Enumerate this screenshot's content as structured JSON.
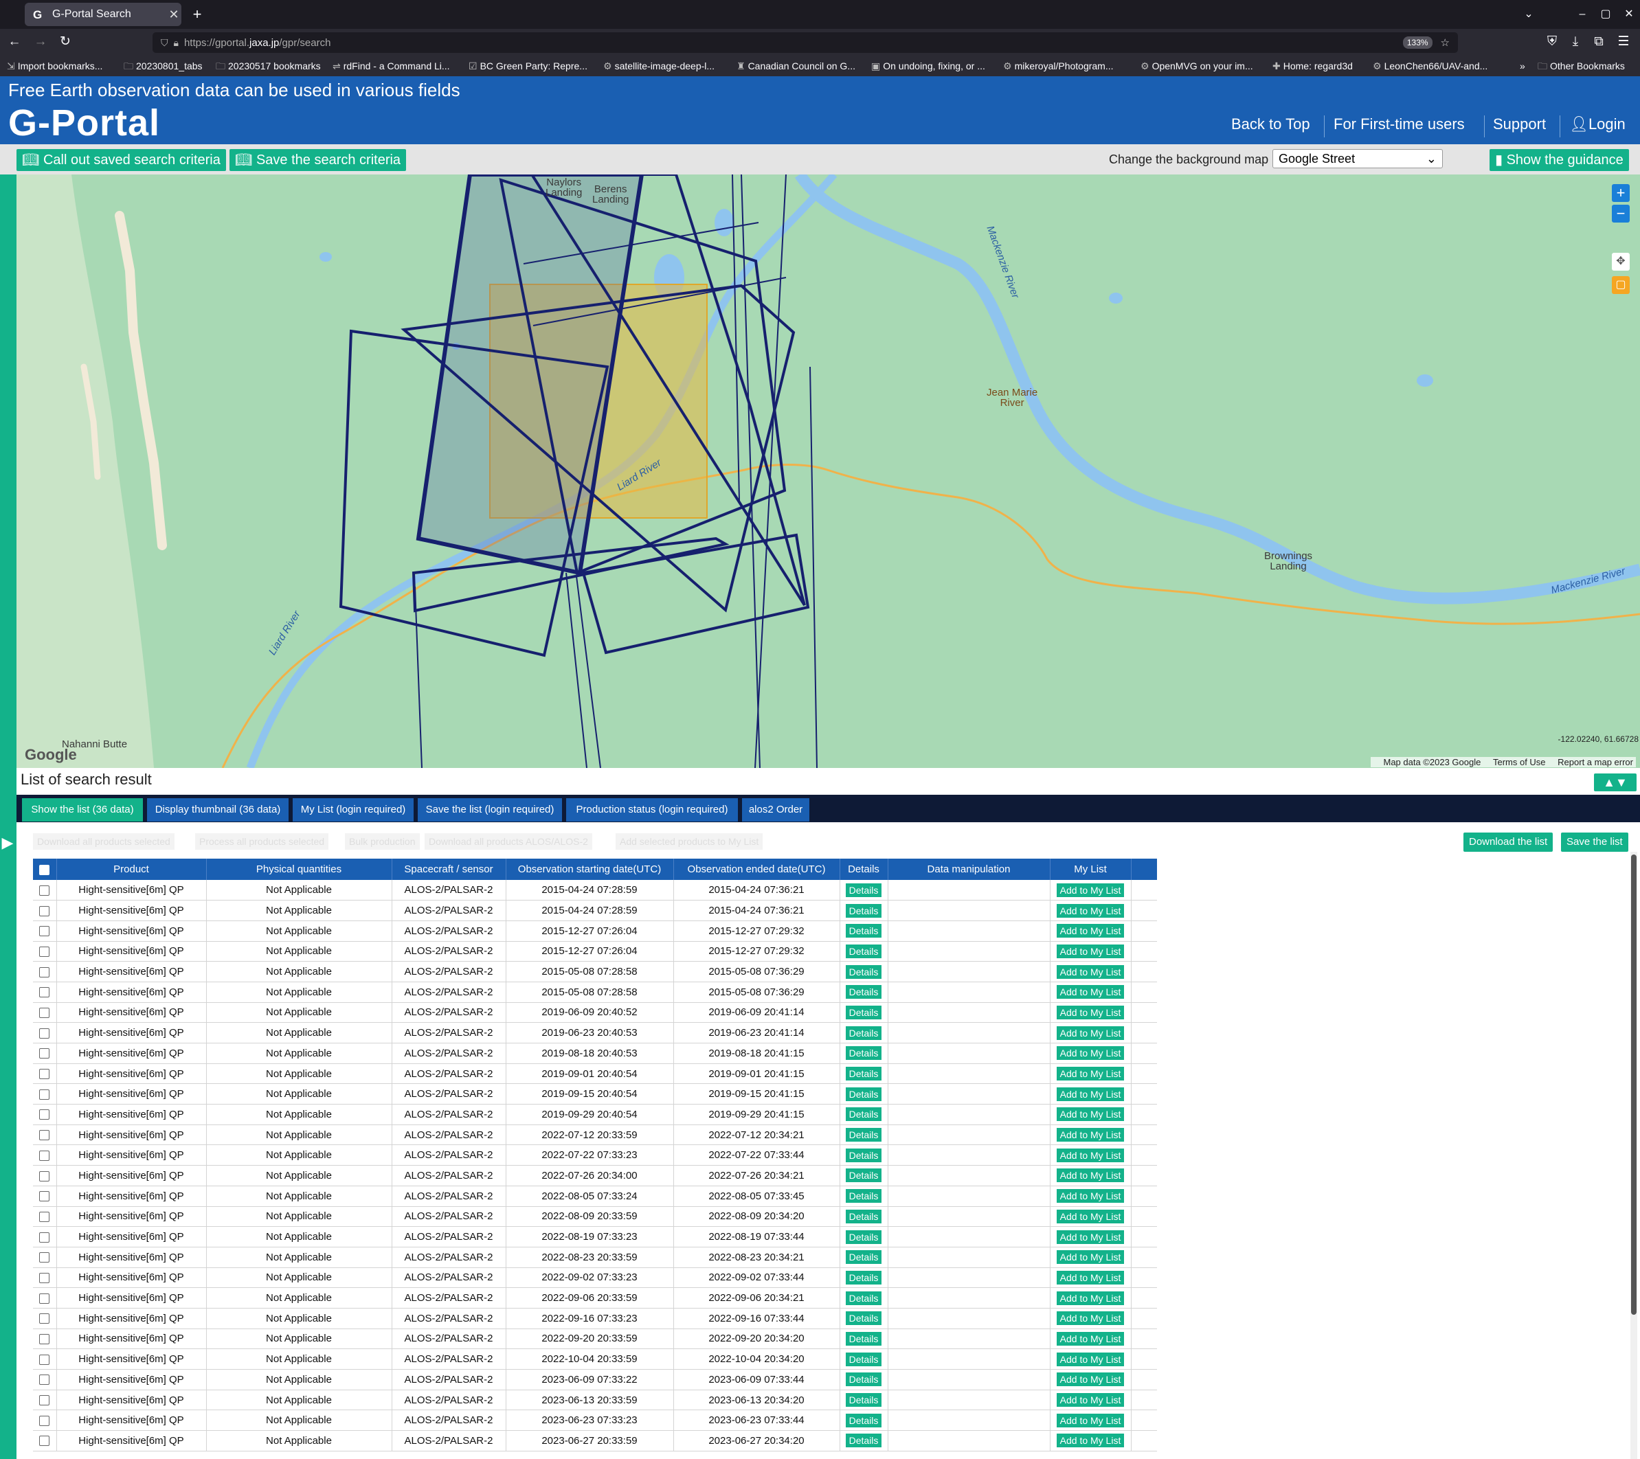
{
  "browser": {
    "tab_title": "G-Portal Search",
    "tab_favicon": "G",
    "url_prefix": "https://gportal.",
    "url_domain": "jaxa.jp",
    "url_path": "/gpr/search",
    "zoom": "133%",
    "bookmarks": [
      "Import bookmarks...",
      "20230801_tabs",
      "20230517 bookmarks",
      "rdFind - a Command Li...",
      "BC Green Party: Repre...",
      "satellite-image-deep-l...",
      "Canadian Council on G...",
      "On undoing, fixing, or ...",
      "mikeroyal/Photogram...",
      "OpenMVG on your im...",
      "Home: regard3d",
      "LeonChen66/UAV-and...",
      "Other Bookmarks"
    ]
  },
  "header": {
    "tagline": "Free Earth observation data can be used in various fields",
    "logo": "G-Portal",
    "nav": [
      "Back to Top",
      "For First-time users",
      "Support",
      "Login"
    ]
  },
  "actions": {
    "call_out": "Call out saved search criteria",
    "save_criteria": "Save the search criteria",
    "bg_label": "Change the background map",
    "bg_value": "Google Street",
    "guidance": "Show the guidance"
  },
  "map": {
    "places": {
      "naylors": "Naylors\nLanding",
      "berens": "Berens\nLanding",
      "mackenzie": "Mackenzie River",
      "jean_marie": "Jean Marie\nRiver",
      "liard1": "Liard River",
      "liard2": "Liard River",
      "brownings": "Brownings\nLanding",
      "mackenzie2": "Mackenzie River",
      "nahanni": "Nahanni Butte"
    },
    "coords": "-122.02240, 61.66728",
    "footer": [
      "Map data ©2023 Google",
      "Terms of Use",
      "Report a map error"
    ],
    "google": "Google",
    "colors": {
      "footprint": "#16206e",
      "aoi": "#e8b842",
      "land": "#a8d9b4",
      "water": "#8fc4ee"
    }
  },
  "results": {
    "title": "List of search result",
    "tabs": [
      "Show the list (36 data)",
      "Display thumbnail (36 data)",
      "My List (login required)",
      "Save the list (login required)",
      "Production status (login required)",
      "alos2 Order"
    ],
    "disabled_buttons": [
      "Download all products selected",
      "Process all products selected",
      "Bulk production",
      "Download all products ALOS/ALOS-2",
      "Add selected products to My List"
    ],
    "download_list": "Download the list",
    "save_list": "Save the list",
    "columns": [
      "Product",
      "Physical quantities",
      "Spacecraft / sensor",
      "Observation starting date(UTC)",
      "Observation ended date(UTC)",
      "Details",
      "Data manipulation",
      "My List"
    ],
    "details_label": "Details",
    "add_label": "Add to My List",
    "rows": [
      [
        "Hight-sensitive[6m] QP",
        "Not Applicable",
        "ALOS-2/PALSAR-2",
        "2015-04-24 07:28:59",
        "2015-04-24 07:36:21"
      ],
      [
        "Hight-sensitive[6m] QP",
        "Not Applicable",
        "ALOS-2/PALSAR-2",
        "2015-04-24 07:28:59",
        "2015-04-24 07:36:21"
      ],
      [
        "Hight-sensitive[6m] QP",
        "Not Applicable",
        "ALOS-2/PALSAR-2",
        "2015-12-27 07:26:04",
        "2015-12-27 07:29:32"
      ],
      [
        "Hight-sensitive[6m] QP",
        "Not Applicable",
        "ALOS-2/PALSAR-2",
        "2015-12-27 07:26:04",
        "2015-12-27 07:29:32"
      ],
      [
        "Hight-sensitive[6m] QP",
        "Not Applicable",
        "ALOS-2/PALSAR-2",
        "2015-05-08 07:28:58",
        "2015-05-08 07:36:29"
      ],
      [
        "Hight-sensitive[6m] QP",
        "Not Applicable",
        "ALOS-2/PALSAR-2",
        "2015-05-08 07:28:58",
        "2015-05-08 07:36:29"
      ],
      [
        "Hight-sensitive[6m] QP",
        "Not Applicable",
        "ALOS-2/PALSAR-2",
        "2019-06-09 20:40:52",
        "2019-06-09 20:41:14"
      ],
      [
        "Hight-sensitive[6m] QP",
        "Not Applicable",
        "ALOS-2/PALSAR-2",
        "2019-06-23 20:40:53",
        "2019-06-23 20:41:14"
      ],
      [
        "Hight-sensitive[6m] QP",
        "Not Applicable",
        "ALOS-2/PALSAR-2",
        "2019-08-18 20:40:53",
        "2019-08-18 20:41:15"
      ],
      [
        "Hight-sensitive[6m] QP",
        "Not Applicable",
        "ALOS-2/PALSAR-2",
        "2019-09-01 20:40:54",
        "2019-09-01 20:41:15"
      ],
      [
        "Hight-sensitive[6m] QP",
        "Not Applicable",
        "ALOS-2/PALSAR-2",
        "2019-09-15 20:40:54",
        "2019-09-15 20:41:15"
      ],
      [
        "Hight-sensitive[6m] QP",
        "Not Applicable",
        "ALOS-2/PALSAR-2",
        "2019-09-29 20:40:54",
        "2019-09-29 20:41:15"
      ],
      [
        "Hight-sensitive[6m] QP",
        "Not Applicable",
        "ALOS-2/PALSAR-2",
        "2022-07-12 20:33:59",
        "2022-07-12 20:34:21"
      ],
      [
        "Hight-sensitive[6m] QP",
        "Not Applicable",
        "ALOS-2/PALSAR-2",
        "2022-07-22 07:33:23",
        "2022-07-22 07:33:44"
      ],
      [
        "Hight-sensitive[6m] QP",
        "Not Applicable",
        "ALOS-2/PALSAR-2",
        "2022-07-26 20:34:00",
        "2022-07-26 20:34:21"
      ],
      [
        "Hight-sensitive[6m] QP",
        "Not Applicable",
        "ALOS-2/PALSAR-2",
        "2022-08-05 07:33:24",
        "2022-08-05 07:33:45"
      ],
      [
        "Hight-sensitive[6m] QP",
        "Not Applicable",
        "ALOS-2/PALSAR-2",
        "2022-08-09 20:33:59",
        "2022-08-09 20:34:20"
      ],
      [
        "Hight-sensitive[6m] QP",
        "Not Applicable",
        "ALOS-2/PALSAR-2",
        "2022-08-19 07:33:23",
        "2022-08-19 07:33:44"
      ],
      [
        "Hight-sensitive[6m] QP",
        "Not Applicable",
        "ALOS-2/PALSAR-2",
        "2022-08-23 20:33:59",
        "2022-08-23 20:34:21"
      ],
      [
        "Hight-sensitive[6m] QP",
        "Not Applicable",
        "ALOS-2/PALSAR-2",
        "2022-09-02 07:33:23",
        "2022-09-02 07:33:44"
      ],
      [
        "Hight-sensitive[6m] QP",
        "Not Applicable",
        "ALOS-2/PALSAR-2",
        "2022-09-06 20:33:59",
        "2022-09-06 20:34:21"
      ],
      [
        "Hight-sensitive[6m] QP",
        "Not Applicable",
        "ALOS-2/PALSAR-2",
        "2022-09-16 07:33:23",
        "2022-09-16 07:33:44"
      ],
      [
        "Hight-sensitive[6m] QP",
        "Not Applicable",
        "ALOS-2/PALSAR-2",
        "2022-09-20 20:33:59",
        "2022-09-20 20:34:20"
      ],
      [
        "Hight-sensitive[6m] QP",
        "Not Applicable",
        "ALOS-2/PALSAR-2",
        "2022-10-04 20:33:59",
        "2022-10-04 20:34:20"
      ],
      [
        "Hight-sensitive[6m] QP",
        "Not Applicable",
        "ALOS-2/PALSAR-2",
        "2023-06-09 07:33:22",
        "2023-06-09 07:33:44"
      ],
      [
        "Hight-sensitive[6m] QP",
        "Not Applicable",
        "ALOS-2/PALSAR-2",
        "2023-06-13 20:33:59",
        "2023-06-13 20:34:20"
      ],
      [
        "Hight-sensitive[6m] QP",
        "Not Applicable",
        "ALOS-2/PALSAR-2",
        "2023-06-23 07:33:23",
        "2023-06-23 07:33:44"
      ],
      [
        "Hight-sensitive[6m] QP",
        "Not Applicable",
        "ALOS-2/PALSAR-2",
        "2023-06-27 20:33:59",
        "2023-06-27 20:34:20"
      ]
    ]
  }
}
